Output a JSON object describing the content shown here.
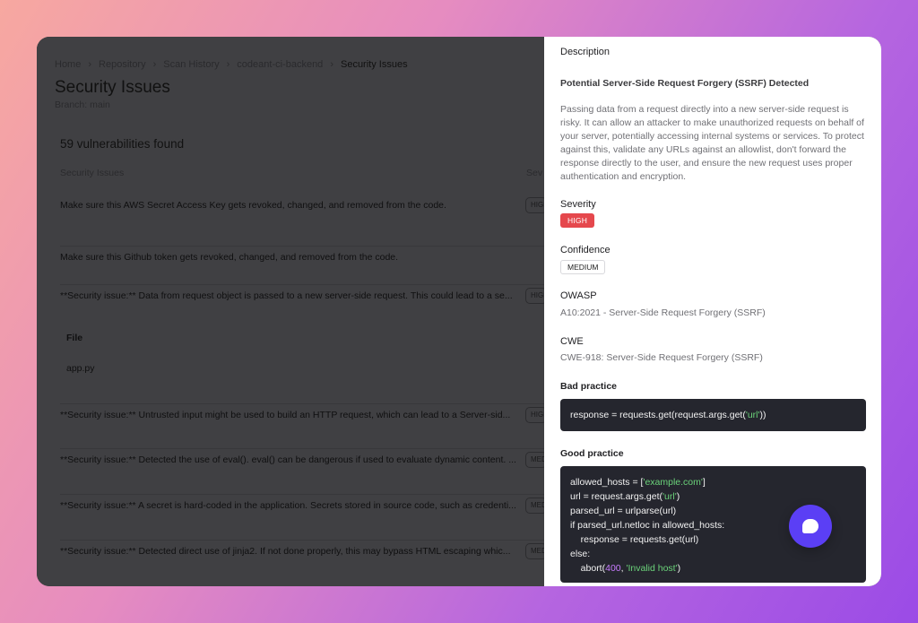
{
  "breadcrumb": [
    "Home",
    "Repository",
    "Scan History",
    "codeant-ci-backend",
    "Security Issues"
  ],
  "page": {
    "title": "Security Issues",
    "branch": "Branch: main",
    "vuln_count": "59 vulnerabilities found"
  },
  "table": {
    "col_issue": "Security Issues",
    "col_severity": "Severity",
    "rows": [
      {
        "text": "Make sure this AWS Secret Access Key gets revoked, changed, and removed from the code.",
        "sev": "HIGH"
      },
      {
        "text": "Make sure this Github token gets revoked, changed, and removed from the code.",
        "sev": ""
      },
      {
        "text": "**Security issue:** Data from request object is passed to a new server-side request. This could lead to a se...",
        "sev": "HIGH"
      },
      {
        "text": "**Security issue:** Untrusted input might be used to build an HTTP request, which can lead to a Server-sid...",
        "sev": "HIGH"
      },
      {
        "text": "**Security issue:** Detected the use of eval(). eval() can be dangerous if used to evaluate dynamic content. ...",
        "sev": "MEDIUM"
      },
      {
        "text": "**Security issue:** A secret is hard-coded in the application. Secrets stored in source code, such as credenti...",
        "sev": "MEDIUM"
      },
      {
        "text": "**Security issue:** Detected direct use of jinja2. If not done properly, this may bypass HTML escaping whic...",
        "sev": "MEDIUM"
      }
    ],
    "file_label": "File",
    "file_value": "app.py"
  },
  "panel": {
    "description_label": "Description",
    "title": "Potential Server-Side Request Forgery (SSRF) Detected",
    "body": "Passing data from a request directly into a new server-side request is risky. It can allow an attacker to make unauthorized requests on behalf of your server, potentially accessing internal systems or services. To protect against this, validate any URLs against an allowlist, don't forward the response directly to the user, and ensure the new request uses proper authentication and encryption.",
    "severity_label": "Severity",
    "severity_value": "HIGH",
    "confidence_label": "Confidence",
    "confidence_value": "MEDIUM",
    "owasp_label": "OWASP",
    "owasp_value": "A10:2021 - Server-Side Request Forgery (SSRF)",
    "cwe_label": "CWE",
    "cwe_value": "CWE-918: Server-Side Request Forgery (SSRF)",
    "bad_label": "Bad practice",
    "bad_code": {
      "prefix": "response = requests.get(request.args.get(",
      "str": "'url'",
      "suffix": "))"
    },
    "good_label": "Good practice",
    "good_code": {
      "l1_a": "allowed_hosts = [",
      "l1_s": "'example.com'",
      "l1_b": "]",
      "l2_a": "url = request.args.get(",
      "l2_s": "'url'",
      "l2_b": ")",
      "l3": "parsed_url = urlparse(url)",
      "l4": "if parsed_url.netloc in allowed_hosts:",
      "l5": "    response = requests.get(url)",
      "l6": "else:",
      "l7_a": "    abort(",
      "l7_n": "400",
      "l7_c": ", ",
      "l7_s": "'Invalid host'",
      "l7_b": ")"
    }
  },
  "colors": {
    "high": "#e5484d",
    "chat_button": "#5b3ff5",
    "code_bg": "#25262e",
    "code_string": "#6bd37a",
    "code_number": "#c87cff"
  },
  "icons": {
    "chat": "chat-bubble-icon"
  }
}
